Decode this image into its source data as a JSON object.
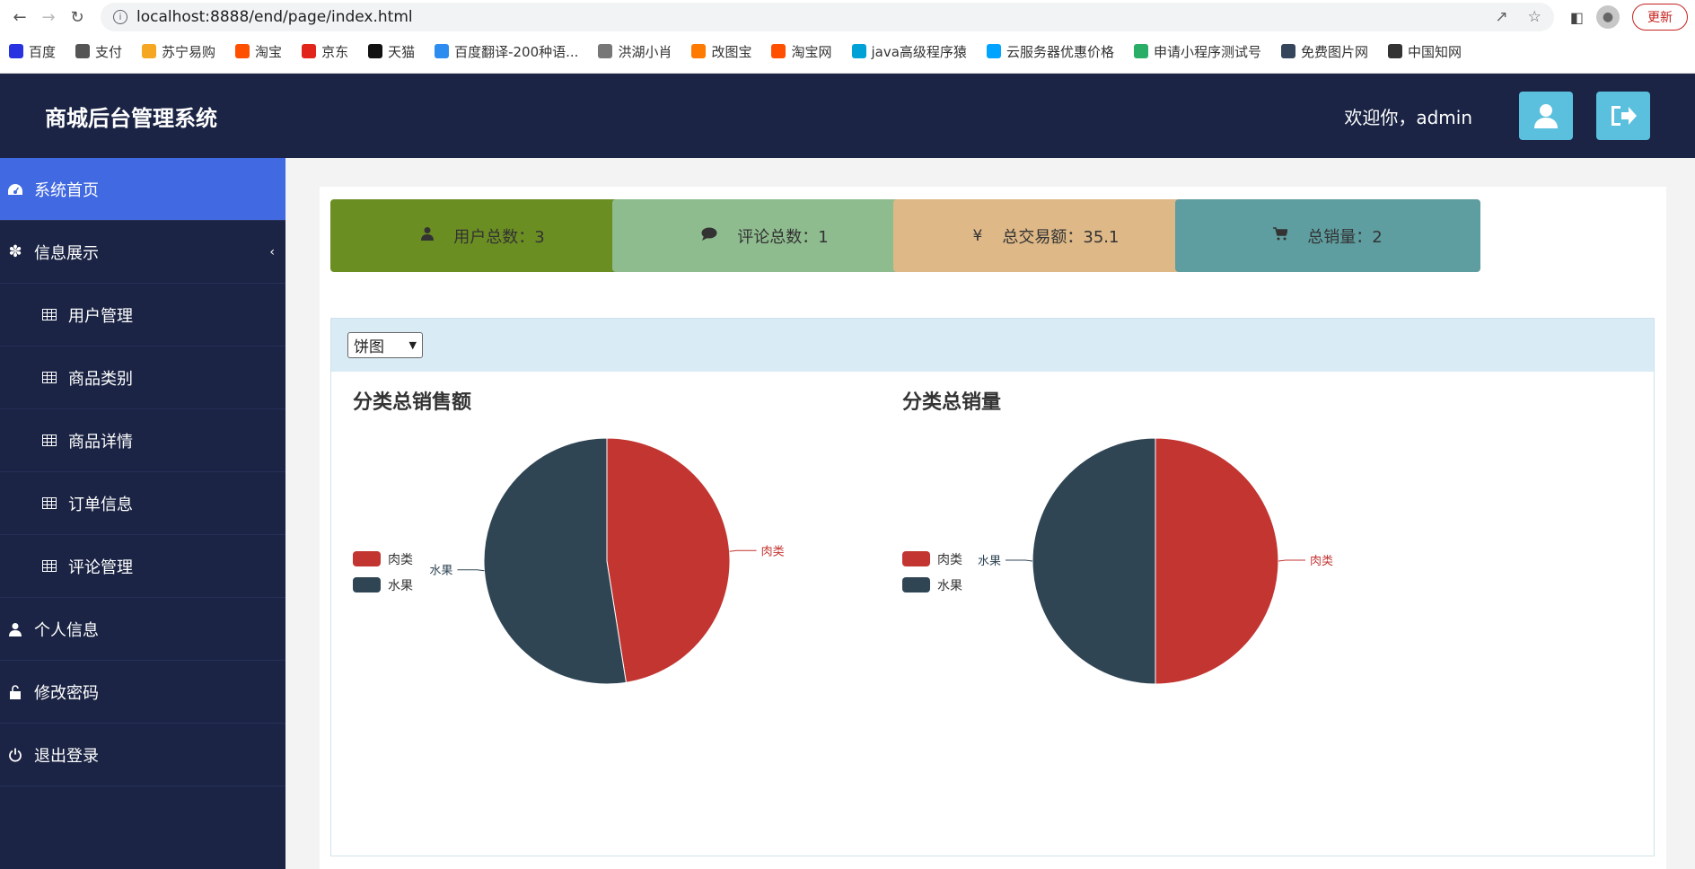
{
  "browser": {
    "url": "localhost:8888/end/page/index.html",
    "update_label": "更新",
    "bookmarks": [
      {
        "label": "百度",
        "color": "#2932e1",
        "icon": "baidu-icon"
      },
      {
        "label": "支付",
        "color": "#555555",
        "icon": "pay-icon"
      },
      {
        "label": "苏宁易购",
        "color": "#f5a623",
        "icon": "suning-icon"
      },
      {
        "label": "淘宝",
        "color": "#ff5000",
        "icon": "taobao-icon"
      },
      {
        "label": "京东",
        "color": "#e1251b",
        "icon": "jd-icon"
      },
      {
        "label": "天猫",
        "color": "#111111",
        "icon": "tmall-icon"
      },
      {
        "label": "百度翻译-200种语...",
        "color": "#2d8cf0",
        "icon": "translate-icon"
      },
      {
        "label": "洪湖小肖",
        "color": "#777777",
        "icon": "bird-icon"
      },
      {
        "label": "改图宝",
        "color": "#ff7a00",
        "icon": "image-tool-icon"
      },
      {
        "label": "淘宝网",
        "color": "#ff5000",
        "icon": "taobao-icon"
      },
      {
        "label": "java高级程序猿",
        "color": "#00a1d6",
        "icon": "bilibili-icon"
      },
      {
        "label": "云服务器优惠价格",
        "color": "#00a3ff",
        "icon": "cloud-icon"
      },
      {
        "label": "申请小程序测试号",
        "color": "#2aae67",
        "icon": "wechat-icon"
      },
      {
        "label": "免费图片网",
        "color": "#35465c",
        "icon": "tumblr-icon"
      },
      {
        "label": "中国知网",
        "color": "#333333",
        "icon": "cnki-icon"
      }
    ]
  },
  "header": {
    "brand": "商城后台管理系统",
    "welcome": "欢迎你，admin"
  },
  "sidebar": {
    "items": [
      {
        "label": "系统首页",
        "icon": "dashboard-icon",
        "active": true
      },
      {
        "label": "信息展示",
        "icon": "asterisk-icon"
      },
      {
        "label": "用户管理",
        "icon": "table-icon"
      },
      {
        "label": "商品类别",
        "icon": "table-icon"
      },
      {
        "label": "商品详情",
        "icon": "table-icon"
      },
      {
        "label": "订单信息",
        "icon": "table-icon"
      },
      {
        "label": "评论管理",
        "icon": "table-icon"
      },
      {
        "label": "个人信息",
        "icon": "user-icon"
      },
      {
        "label": "修改密码",
        "icon": "unlock-icon"
      },
      {
        "label": "退出登录",
        "icon": "power-icon"
      }
    ]
  },
  "stats": [
    {
      "label": "用户总数：3",
      "icon": "user-icon",
      "color": "#6b8e23"
    },
    {
      "label": "评论总数：1",
      "icon": "comment-icon",
      "color": "#8fbc8f"
    },
    {
      "label": "总交易额：35.1",
      "icon": "yen-icon",
      "color": "#deb887"
    },
    {
      "label": "总销量：2",
      "icon": "cart-icon",
      "color": "#5f9ea0"
    }
  ],
  "chart_select": {
    "value": "饼图"
  },
  "chart_data": [
    {
      "type": "pie",
      "title": "分类总销售额",
      "categories": [
        "肉类",
        "水果"
      ],
      "values": [
        47.5,
        52.5
      ],
      "colors": [
        "#c23531",
        "#2f4554"
      ],
      "legend": "left"
    },
    {
      "type": "pie",
      "title": "分类总销量",
      "categories": [
        "肉类",
        "水果"
      ],
      "values": [
        1,
        1
      ],
      "colors": [
        "#c23531",
        "#2f4554"
      ],
      "legend": "left"
    }
  ]
}
